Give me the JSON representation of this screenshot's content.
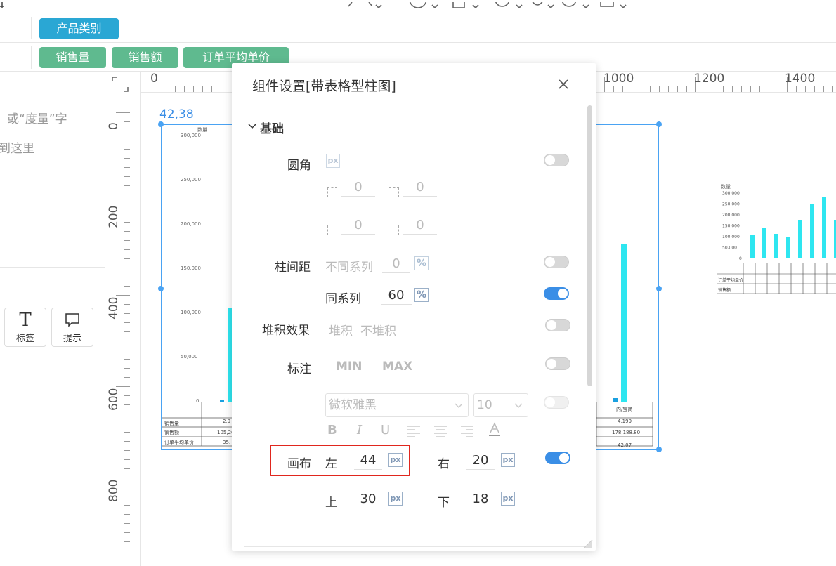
{
  "filters": {
    "category_chip": "产品类别",
    "measure_chips": [
      "销售量",
      "销售额",
      "订单平均单价"
    ]
  },
  "left_panel": {
    "hint_line1": "或“度量”字",
    "hint_line2": "到这里",
    "tools": [
      {
        "label": "标签",
        "icon": "T"
      },
      {
        "label": "提示",
        "icon": "speech-bubble-icon"
      }
    ]
  },
  "ruler": {
    "h_labels": [
      "0",
      "1000",
      "1200",
      "1400"
    ],
    "v_labels": [
      "0",
      "200",
      "400",
      "600",
      "800"
    ]
  },
  "selection": {
    "coords": "42,38"
  },
  "bg_chart": {
    "y_title": "数量",
    "y_ticks": [
      "300,000",
      "250,000",
      "200,000",
      "150,000",
      "100,000",
      "50,000",
      "0"
    ],
    "visible_cells": [
      "2,9",
      "4,199",
      "105,26",
      "178,188.80",
      "35.",
      "42.07",
      "内/宝商"
    ],
    "row_labels": [
      "销售量",
      "销售额",
      "订单平均单价"
    ]
  },
  "mini_chart": {
    "y_title": "数量",
    "y_ticks": [
      "300,000",
      "250,000",
      "200,000",
      "150,000",
      "100,000",
      "50,000",
      "0"
    ],
    "row_labels": [
      "订单平均单价",
      "销售额"
    ]
  },
  "dialog": {
    "title": "组件设置[带表格型柱图]",
    "section": "基础",
    "radius": {
      "label": "圆角",
      "tl": "0",
      "tr": "0",
      "bl": "0",
      "br": "0"
    },
    "bar_gap": {
      "label": "柱间距",
      "diff_series": "不同系列",
      "diff_value": "0",
      "same_series": "同系列",
      "same_value": "60"
    },
    "stack": {
      "label": "堆积效果",
      "opt1": "堆积",
      "opt2": "不堆积"
    },
    "mark": {
      "label": "标注",
      "min": "MIN",
      "max": "MAX"
    },
    "font": {
      "family": "微软雅黑",
      "size": "10"
    },
    "canvas": {
      "label": "画布",
      "left_label": "左",
      "left": "44",
      "right_label": "右",
      "right": "20",
      "top_label": "上",
      "top": "30",
      "bottom_label": "下",
      "bottom": "18"
    },
    "unit_px": "px",
    "unit_pct": "%"
  },
  "accent_colors": {
    "chip_blue": "#2aa7d4",
    "chip_green": "#5fba8f",
    "bar": "#2ee6f0",
    "highlight": "#e0271e"
  }
}
